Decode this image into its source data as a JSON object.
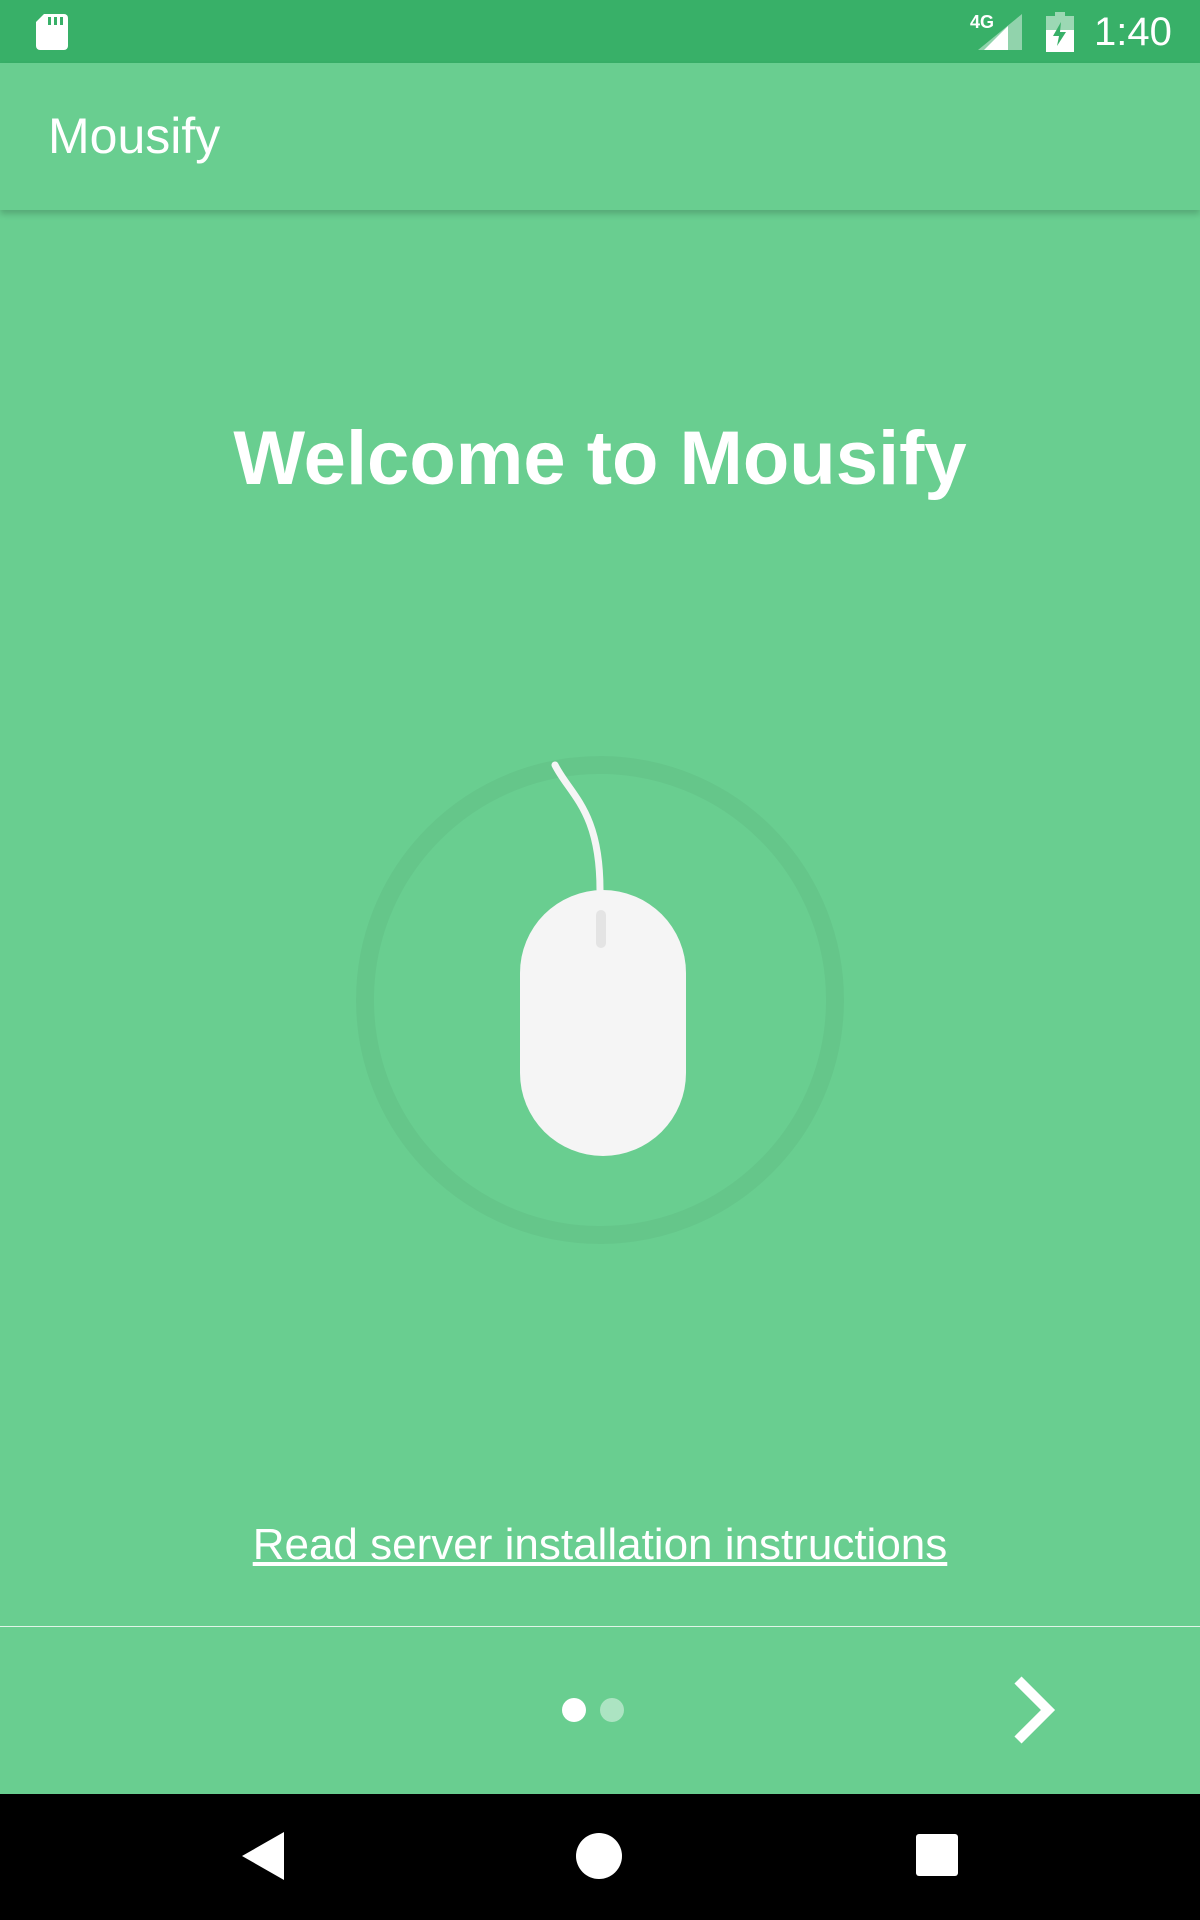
{
  "status_bar": {
    "time": "1:40",
    "network": "4G",
    "icons": [
      "sd-card-icon",
      "signal-icon",
      "battery-charging-icon"
    ]
  },
  "app_bar": {
    "title": "Mousify"
  },
  "main": {
    "heading": "Welcome to Mousify",
    "illustration": "computer-mouse-icon",
    "link_text": "Read server installation instructions"
  },
  "pager": {
    "current_page": 1,
    "total_pages": 2,
    "next_icon": "chevron-right-icon"
  },
  "nav_bar": {
    "buttons": [
      "back-icon",
      "home-icon",
      "recents-icon"
    ]
  },
  "colors": {
    "status_bar": "#38B068",
    "background": "#69CE90",
    "foreground": "#FFFFFF",
    "nav_bar": "#000000"
  }
}
